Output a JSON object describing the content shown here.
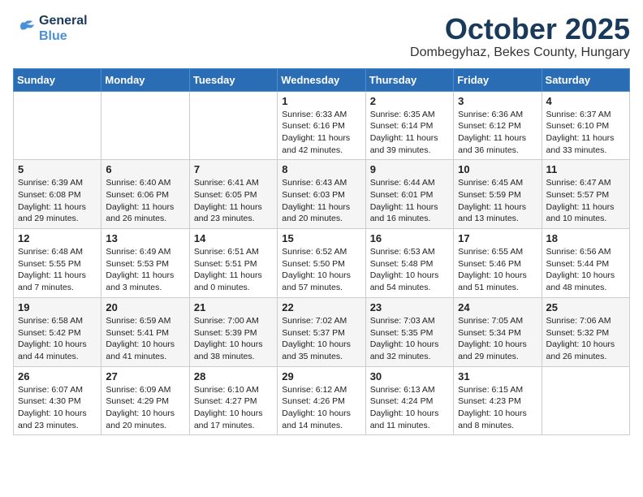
{
  "header": {
    "logo_line1": "General",
    "logo_line2": "Blue",
    "month": "October 2025",
    "location": "Dombegyhaz, Bekes County, Hungary"
  },
  "weekdays": [
    "Sunday",
    "Monday",
    "Tuesday",
    "Wednesday",
    "Thursday",
    "Friday",
    "Saturday"
  ],
  "weeks": [
    [
      {
        "day": "",
        "info": ""
      },
      {
        "day": "",
        "info": ""
      },
      {
        "day": "",
        "info": ""
      },
      {
        "day": "1",
        "info": "Sunrise: 6:33 AM\nSunset: 6:16 PM\nDaylight: 11 hours\nand 42 minutes."
      },
      {
        "day": "2",
        "info": "Sunrise: 6:35 AM\nSunset: 6:14 PM\nDaylight: 11 hours\nand 39 minutes."
      },
      {
        "day": "3",
        "info": "Sunrise: 6:36 AM\nSunset: 6:12 PM\nDaylight: 11 hours\nand 36 minutes."
      },
      {
        "day": "4",
        "info": "Sunrise: 6:37 AM\nSunset: 6:10 PM\nDaylight: 11 hours\nand 33 minutes."
      }
    ],
    [
      {
        "day": "5",
        "info": "Sunrise: 6:39 AM\nSunset: 6:08 PM\nDaylight: 11 hours\nand 29 minutes."
      },
      {
        "day": "6",
        "info": "Sunrise: 6:40 AM\nSunset: 6:06 PM\nDaylight: 11 hours\nand 26 minutes."
      },
      {
        "day": "7",
        "info": "Sunrise: 6:41 AM\nSunset: 6:05 PM\nDaylight: 11 hours\nand 23 minutes."
      },
      {
        "day": "8",
        "info": "Sunrise: 6:43 AM\nSunset: 6:03 PM\nDaylight: 11 hours\nand 20 minutes."
      },
      {
        "day": "9",
        "info": "Sunrise: 6:44 AM\nSunset: 6:01 PM\nDaylight: 11 hours\nand 16 minutes."
      },
      {
        "day": "10",
        "info": "Sunrise: 6:45 AM\nSunset: 5:59 PM\nDaylight: 11 hours\nand 13 minutes."
      },
      {
        "day": "11",
        "info": "Sunrise: 6:47 AM\nSunset: 5:57 PM\nDaylight: 11 hours\nand 10 minutes."
      }
    ],
    [
      {
        "day": "12",
        "info": "Sunrise: 6:48 AM\nSunset: 5:55 PM\nDaylight: 11 hours\nand 7 minutes."
      },
      {
        "day": "13",
        "info": "Sunrise: 6:49 AM\nSunset: 5:53 PM\nDaylight: 11 hours\nand 3 minutes."
      },
      {
        "day": "14",
        "info": "Sunrise: 6:51 AM\nSunset: 5:51 PM\nDaylight: 11 hours\nand 0 minutes."
      },
      {
        "day": "15",
        "info": "Sunrise: 6:52 AM\nSunset: 5:50 PM\nDaylight: 10 hours\nand 57 minutes."
      },
      {
        "day": "16",
        "info": "Sunrise: 6:53 AM\nSunset: 5:48 PM\nDaylight: 10 hours\nand 54 minutes."
      },
      {
        "day": "17",
        "info": "Sunrise: 6:55 AM\nSunset: 5:46 PM\nDaylight: 10 hours\nand 51 minutes."
      },
      {
        "day": "18",
        "info": "Sunrise: 6:56 AM\nSunset: 5:44 PM\nDaylight: 10 hours\nand 48 minutes."
      }
    ],
    [
      {
        "day": "19",
        "info": "Sunrise: 6:58 AM\nSunset: 5:42 PM\nDaylight: 10 hours\nand 44 minutes."
      },
      {
        "day": "20",
        "info": "Sunrise: 6:59 AM\nSunset: 5:41 PM\nDaylight: 10 hours\nand 41 minutes."
      },
      {
        "day": "21",
        "info": "Sunrise: 7:00 AM\nSunset: 5:39 PM\nDaylight: 10 hours\nand 38 minutes."
      },
      {
        "day": "22",
        "info": "Sunrise: 7:02 AM\nSunset: 5:37 PM\nDaylight: 10 hours\nand 35 minutes."
      },
      {
        "day": "23",
        "info": "Sunrise: 7:03 AM\nSunset: 5:35 PM\nDaylight: 10 hours\nand 32 minutes."
      },
      {
        "day": "24",
        "info": "Sunrise: 7:05 AM\nSunset: 5:34 PM\nDaylight: 10 hours\nand 29 minutes."
      },
      {
        "day": "25",
        "info": "Sunrise: 7:06 AM\nSunset: 5:32 PM\nDaylight: 10 hours\nand 26 minutes."
      }
    ],
    [
      {
        "day": "26",
        "info": "Sunrise: 6:07 AM\nSunset: 4:30 PM\nDaylight: 10 hours\nand 23 minutes."
      },
      {
        "day": "27",
        "info": "Sunrise: 6:09 AM\nSunset: 4:29 PM\nDaylight: 10 hours\nand 20 minutes."
      },
      {
        "day": "28",
        "info": "Sunrise: 6:10 AM\nSunset: 4:27 PM\nDaylight: 10 hours\nand 17 minutes."
      },
      {
        "day": "29",
        "info": "Sunrise: 6:12 AM\nSunset: 4:26 PM\nDaylight: 10 hours\nand 14 minutes."
      },
      {
        "day": "30",
        "info": "Sunrise: 6:13 AM\nSunset: 4:24 PM\nDaylight: 10 hours\nand 11 minutes."
      },
      {
        "day": "31",
        "info": "Sunrise: 6:15 AM\nSunset: 4:23 PM\nDaylight: 10 hours\nand 8 minutes."
      },
      {
        "day": "",
        "info": ""
      }
    ]
  ]
}
